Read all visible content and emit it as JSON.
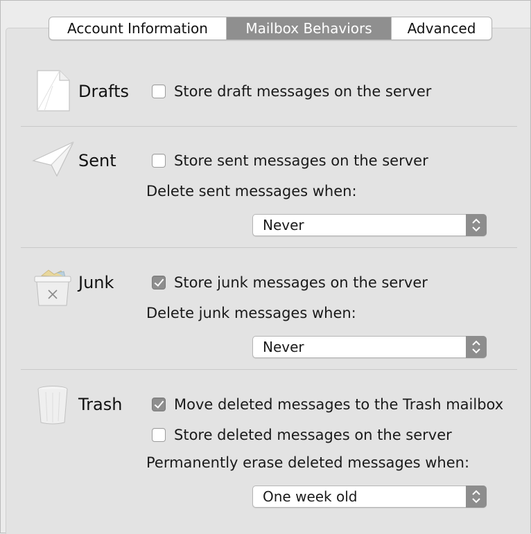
{
  "tabs": [
    {
      "label": "Account Information",
      "selected": false
    },
    {
      "label": "Mailbox Behaviors",
      "selected": true
    },
    {
      "label": "Advanced",
      "selected": false
    }
  ],
  "drafts": {
    "title": "Drafts",
    "icon": "document-icon",
    "store_label": "Store draft messages on the server",
    "store_checked": false
  },
  "sent": {
    "title": "Sent",
    "icon": "paper-plane-icon",
    "store_label": "Store sent messages on the server",
    "store_checked": false,
    "delete_label": "Delete sent messages when:",
    "delete_value": "Never"
  },
  "junk": {
    "title": "Junk",
    "icon": "junk-bin-icon",
    "store_label": "Store junk messages on the server",
    "store_checked": true,
    "delete_label": "Delete junk messages when:",
    "delete_value": "Never"
  },
  "trash": {
    "title": "Trash",
    "icon": "trash-can-icon",
    "move_label": "Move deleted messages to the Trash mailbox",
    "move_checked": true,
    "store_label": "Store deleted messages on the server",
    "store_checked": false,
    "erase_label": "Permanently erase deleted messages when:",
    "erase_value": "One week old"
  },
  "colors": {
    "selected_tab": "#8f8f8f",
    "checked_box": "#8e8e8e",
    "panel_bg": "#e3e3e3"
  }
}
